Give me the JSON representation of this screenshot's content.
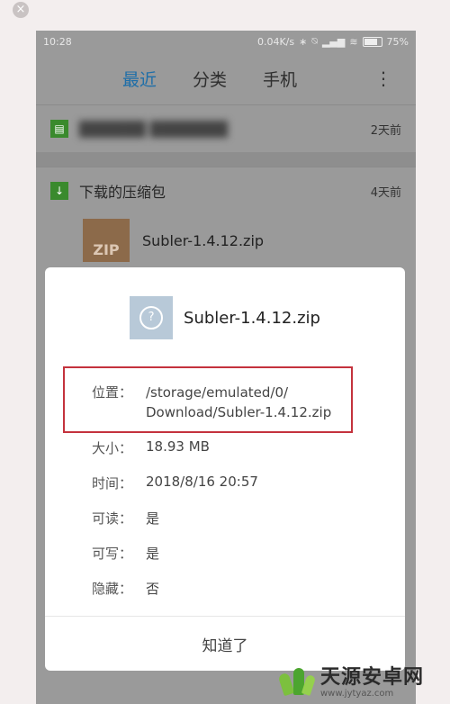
{
  "chrome": {
    "close_glyph": "×"
  },
  "status_bar": {
    "time": "10:28",
    "net_speed": "0.04K/s",
    "icons": [
      "bluetooth-icon",
      "mute-icon",
      "signal-icon",
      "wifi-icon",
      "battery-icon"
    ],
    "battery": "75%"
  },
  "tabs": [
    {
      "label": "最近",
      "active": true
    },
    {
      "label": "分类",
      "active": false
    },
    {
      "label": "手机",
      "active": false
    }
  ],
  "more_glyph": "⋮",
  "list": {
    "row1": {
      "date": "2天前"
    },
    "group": {
      "label": "下载的压缩包",
      "date": "4天前"
    },
    "file": {
      "thumb": "ZIP",
      "name": "Subler-1.4.12.zip"
    }
  },
  "dialog": {
    "title": "Subler-1.4.12.zip",
    "location_label": "位置：",
    "location_line1": "/storage/emulated/0/",
    "location_line2": "Download/Subler-1.4.12.zip",
    "size_label": "大小：",
    "size_value": "18.93 MB",
    "time_label": "时间：",
    "time_value": "2018/8/16 20:57",
    "readable_label": "可读：",
    "readable_value": "是",
    "writable_label": "可写：",
    "writable_value": "是",
    "hidden_label": "隐藏：",
    "hidden_value": "否",
    "ok_label": "知道了"
  },
  "watermark": {
    "brand": "天源安卓网",
    "url": "www.jytyaz.com"
  },
  "colors": {
    "accent": "#1e6ea8",
    "link": "#2f87c9",
    "highlight": "#c4323d"
  }
}
